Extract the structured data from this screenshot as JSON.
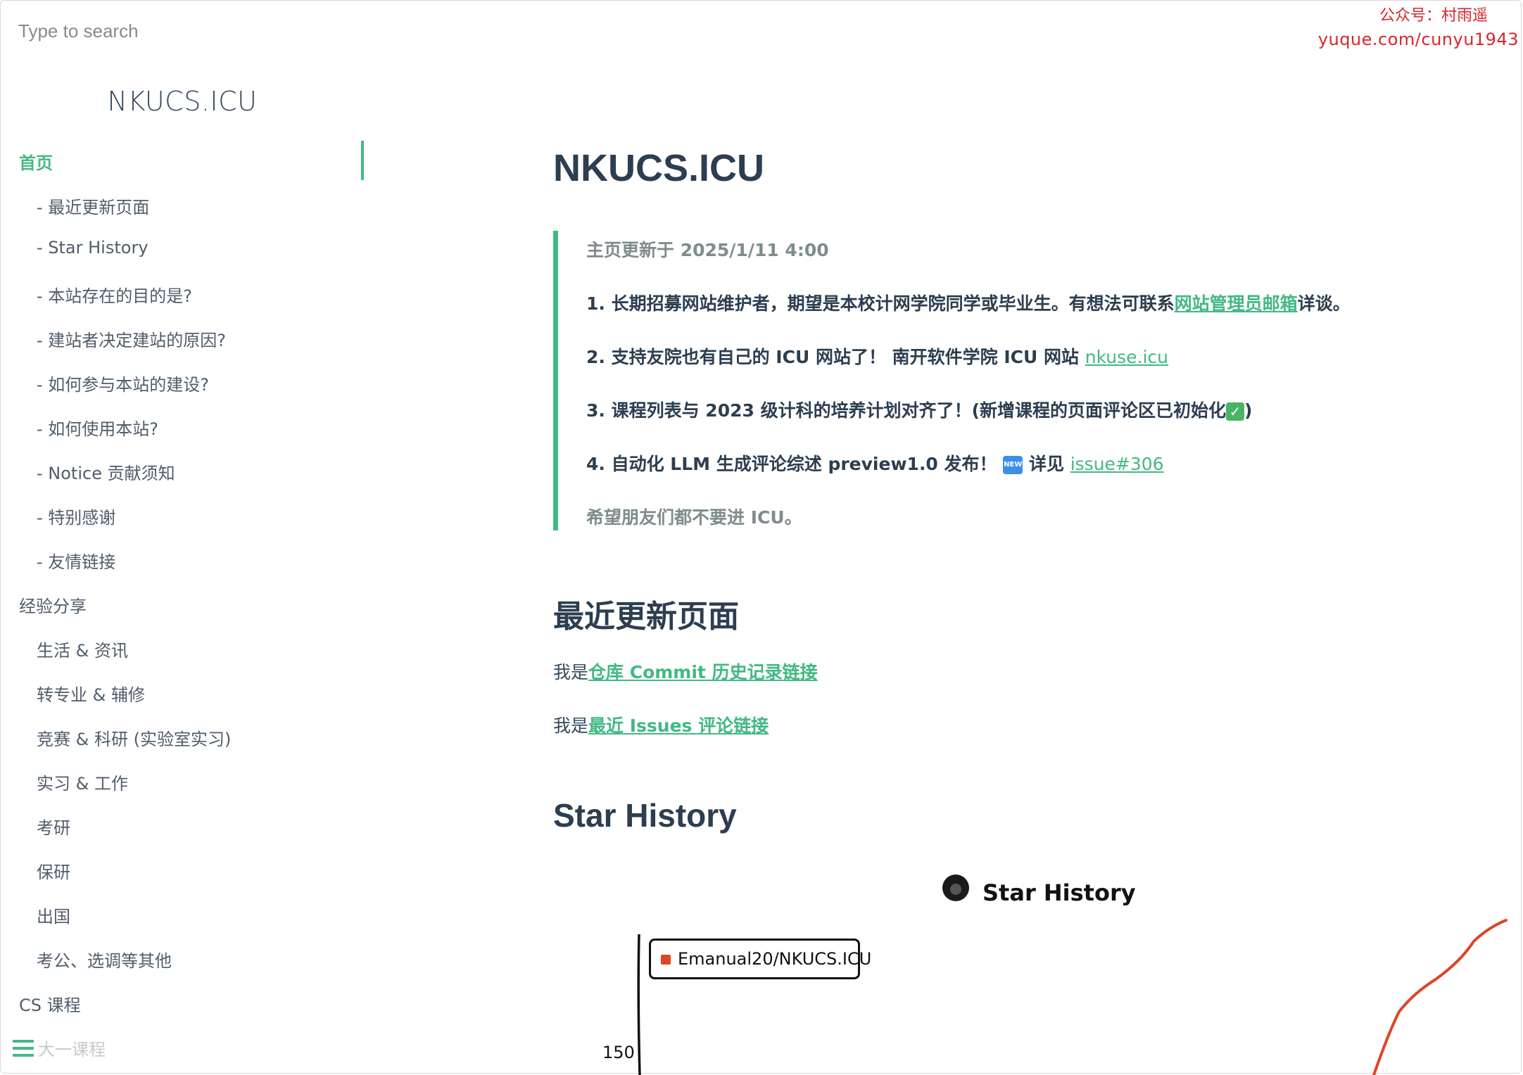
{
  "watermark": {
    "line1": "公众号：村雨遥",
    "line2": "yuque.com/cunyu1943"
  },
  "search": {
    "placeholder": "Type to search"
  },
  "app_name": "NKUCS.ICU",
  "sidebar": {
    "items": [
      {
        "label": "首页",
        "level": "top",
        "active": true
      },
      {
        "label": "- 最近更新页面",
        "level": "sub"
      },
      {
        "label": "- Star History",
        "level": "sub"
      },
      {
        "label": "- 本站存在的目的是?",
        "level": "sub"
      },
      {
        "label": "- 建站者决定建站的原因?",
        "level": "sub"
      },
      {
        "label": "- 如何参与本站的建设?",
        "level": "sub"
      },
      {
        "label": "- 如何使用本站?",
        "level": "sub"
      },
      {
        "label": "- Notice 贡献须知",
        "level": "sub"
      },
      {
        "label": "- 特别感谢",
        "level": "sub"
      },
      {
        "label": "- 友情链接",
        "level": "sub"
      },
      {
        "label": "经验分享",
        "level": "top"
      },
      {
        "label": "生活 & 资讯",
        "level": "sub"
      },
      {
        "label": "转专业 & 辅修",
        "level": "sub"
      },
      {
        "label": "竞赛 & 科研 (实验室实习)",
        "level": "sub"
      },
      {
        "label": "实习 & 工作",
        "level": "sub"
      },
      {
        "label": "考研",
        "level": "sub"
      },
      {
        "label": "保研",
        "level": "sub"
      },
      {
        "label": "出国",
        "level": "sub"
      },
      {
        "label": "考公、选调等其他",
        "level": "sub"
      },
      {
        "label": "CS 课程",
        "level": "top"
      }
    ],
    "faded_item": "大一课程"
  },
  "main": {
    "title": "NKUCS.ICU",
    "notice": {
      "updated": "主页更新于 2025/1/11 4:00",
      "item1_pre": "1. 长期招募网站维护者，期望是本校计网学院同学或毕业生。有想法可联系",
      "item1_link": "网站管理员邮箱",
      "item1_post": "详谈。",
      "item2_pre": "2. 支持友院也有自己的 ICU 网站了！ 南开软件学院 ICU 网站 ",
      "item2_link": "nkuse.icu",
      "item3_pre": "3. 课程列表与 2023 级计科的培养计划对齐了！(新增课程的页面评论区已初始化",
      "item3_check": "✓",
      "item3_post": ")",
      "item4_pre": "4. 自动化 LLM 生成评论综述 preview1.0 发布！",
      "item4_badge": "NEW",
      "item4_mid": "详见 ",
      "item4_link": "issue#306",
      "wish": "希望朋友们都不要进 ICU。"
    },
    "recent_heading": "最近更新页面",
    "recent_p1_pre": "我是",
    "recent_p1_link": "仓库 Commit 历史记录链接",
    "recent_p2_pre": "我是",
    "recent_p2_link": "最近 Issues 评论链接",
    "star_heading": "Star History"
  },
  "chart_data": {
    "type": "line",
    "title": "Star History",
    "series": [
      {
        "name": "Emanual20/NKUCS.ICU",
        "color": "#dd4528"
      }
    ],
    "yticks": [
      "150"
    ]
  }
}
